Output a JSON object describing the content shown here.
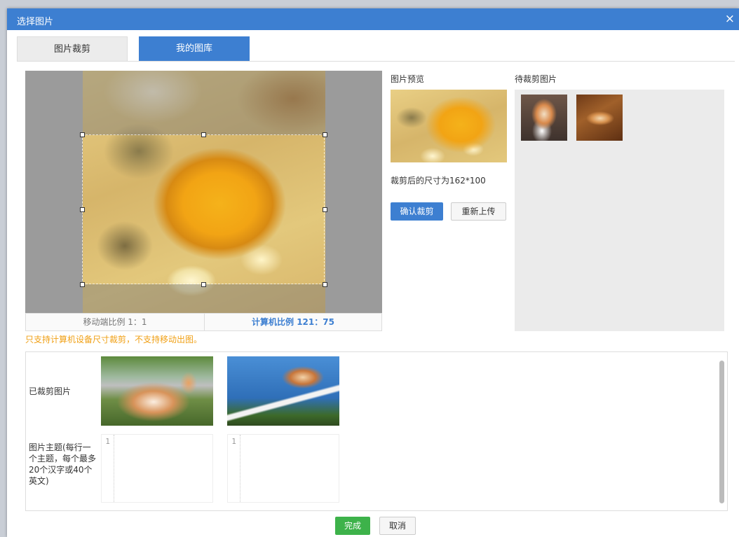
{
  "dialog": {
    "title": "选择图片",
    "close_icon": "×"
  },
  "tabs": [
    {
      "label": "图片裁剪",
      "active": false
    },
    {
      "label": "我的图库",
      "active": true
    }
  ],
  "crop": {
    "mobile_ratio": "移动端比例 1：1",
    "desktop_ratio": "计算机比例 121：75",
    "warning": "只支持计算机设备尺寸裁剪，不支持移动出图。"
  },
  "preview": {
    "label": "图片预览",
    "size_text": "裁剪后的尺寸为162*100",
    "confirm_label": "确认裁剪",
    "reupload_label": "重新上传"
  },
  "pending": {
    "label": "待裁剪图片"
  },
  "cropped": {
    "label": "已裁剪图片",
    "theme_label": "图片主题(每行一个主题，每个最多20个汉字或40个英文)",
    "editors": [
      {
        "line_number": "1"
      },
      {
        "line_number": "1"
      }
    ]
  },
  "footer": {
    "done_label": "完成",
    "cancel_label": "取消"
  },
  "colors": {
    "accent": "#3d7fd1",
    "success": "#3db24a",
    "warning": "#f0a015"
  }
}
